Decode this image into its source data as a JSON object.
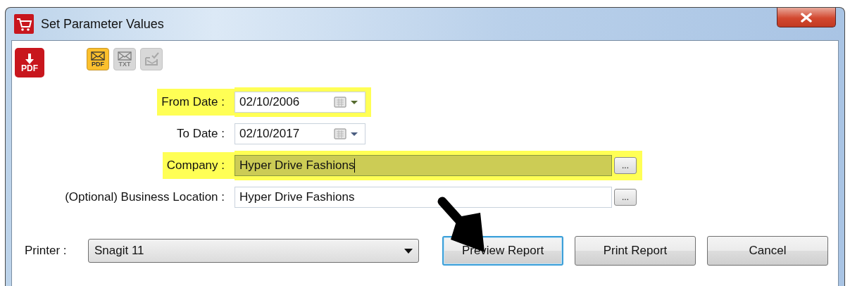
{
  "window": {
    "title": "Set Parameter Values"
  },
  "toolbar": [
    {
      "kind": "pdf-download",
      "label": "PDF",
      "disabled": false
    },
    {
      "kind": "email",
      "label": "PDF",
      "disabled": false
    },
    {
      "kind": "email",
      "label": "TXT",
      "disabled": true
    },
    {
      "kind": "email-check",
      "disabled": true
    }
  ],
  "parameters": [
    {
      "label": "From Date :",
      "kind": "date",
      "value": "02/10/2006",
      "highlighted": true,
      "text_selected": false
    },
    {
      "label": "To Date :",
      "kind": "date",
      "value": "02/10/2017",
      "highlighted": false,
      "text_selected": false
    },
    {
      "label": "Company :",
      "kind": "lookup",
      "value": "Hyper Drive Fashions",
      "button": "...",
      "highlighted": true,
      "text_selected": true
    },
    {
      "label": "(Optional) Business Location :",
      "kind": "lookup",
      "value": "Hyper Drive Fashions",
      "button": "...",
      "highlighted": false,
      "text_selected": false
    }
  ],
  "printer": {
    "label": "Printer :",
    "value": "Snagit 11"
  },
  "buttons": [
    {
      "label": "Preview Report",
      "focused": true
    },
    {
      "label": "Print Report",
      "focused": false
    },
    {
      "label": "Cancel",
      "focused": false
    }
  ],
  "annotations": [
    {
      "kind": "arrow"
    }
  ]
}
